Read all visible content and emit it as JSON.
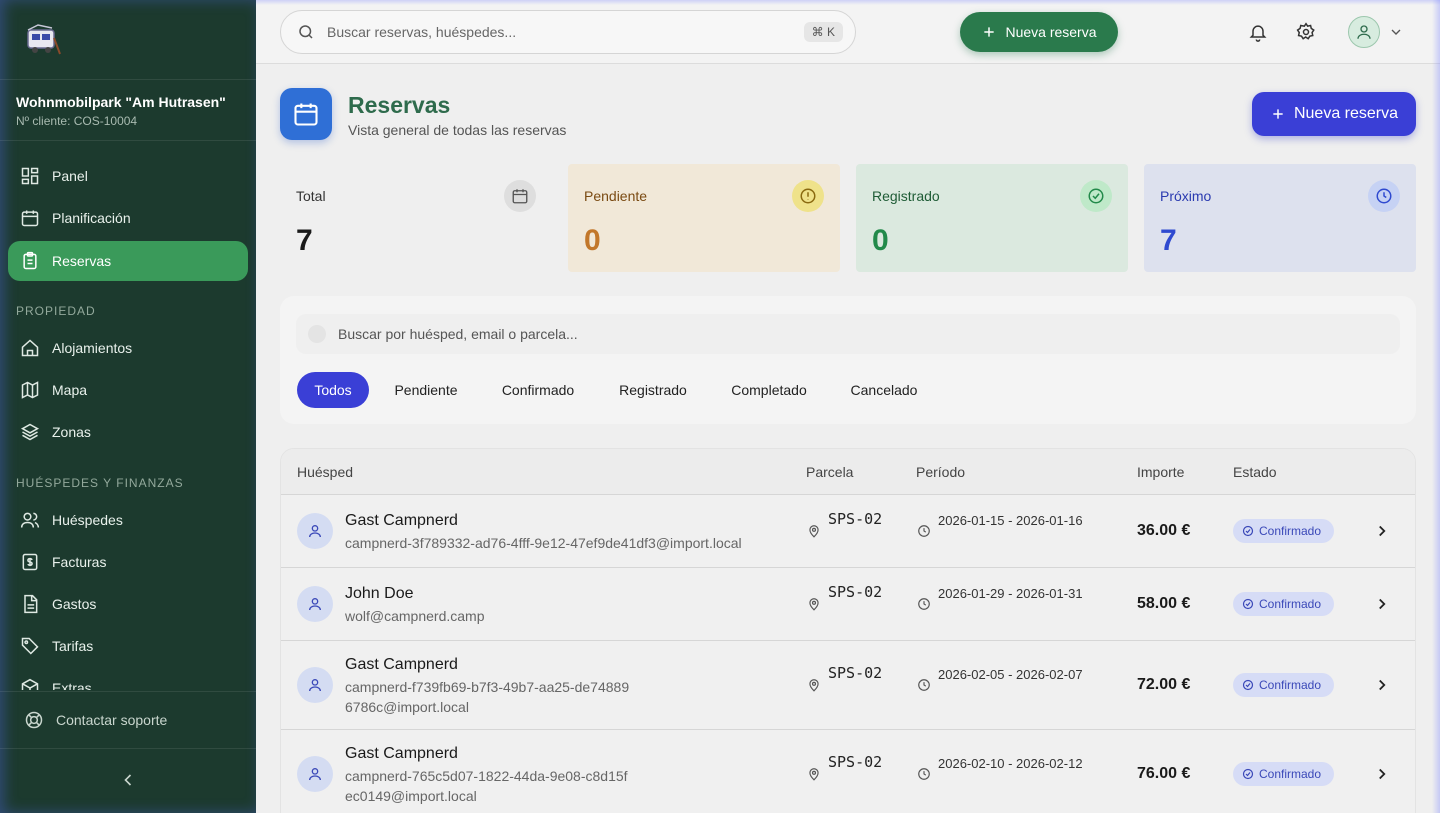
{
  "sidebar": {
    "park_name": "Wohnmobilpark \"Am Hutrasen\"",
    "client_number": "Nº cliente: COS-10004",
    "items": [
      {
        "label": "Panel",
        "icon": "dashboard-icon"
      },
      {
        "label": "Planificación",
        "icon": "calendar-icon"
      },
      {
        "label": "Reservas",
        "icon": "clipboard-icon",
        "active": true
      }
    ],
    "section_property": "PROPIEDAD",
    "property_items": [
      {
        "label": "Alojamientos",
        "icon": "home-icon"
      },
      {
        "label": "Mapa",
        "icon": "map-icon"
      },
      {
        "label": "Zonas",
        "icon": "layers-icon"
      }
    ],
    "section_guests": "HUÉSPEDES Y FINANZAS",
    "guest_items": [
      {
        "label": "Huéspedes",
        "icon": "users-icon"
      },
      {
        "label": "Facturas",
        "icon": "invoice-icon"
      },
      {
        "label": "Gastos",
        "icon": "receipt-icon"
      },
      {
        "label": "Tarifas",
        "icon": "tag-icon"
      },
      {
        "label": "Extras",
        "icon": "package-icon"
      }
    ],
    "support_label": "Contactar soporte"
  },
  "topbar": {
    "search_placeholder": "Buscar reservas, huéspedes...",
    "shortcut": "⌘ K",
    "new_booking": "Nueva reserva"
  },
  "header": {
    "title": "Reservas",
    "subtitle": "Vista general de todas las reservas",
    "new_booking": "Nueva reserva"
  },
  "stats": [
    {
      "label": "Total",
      "value": "7"
    },
    {
      "label": "Pendiente",
      "value": "0"
    },
    {
      "label": "Registrado",
      "value": "0"
    },
    {
      "label": "Próximo",
      "value": "7"
    }
  ],
  "filters": {
    "search_placeholder": "Buscar por huésped, email o parcela...",
    "chips": [
      "Todos",
      "Pendiente",
      "Confirmado",
      "Registrado",
      "Completado",
      "Cancelado"
    ],
    "active": "Todos"
  },
  "table": {
    "columns": [
      "Huésped",
      "Parcela",
      "Período",
      "Importe",
      "Estado"
    ],
    "rows": [
      {
        "name": "Gast Campnerd",
        "email": "campnerd-3f789332-ad76-4fff-9e12-47ef9de41df3@import.local",
        "plot": "SPS-02",
        "period": "2026-01-15 - 2026-01-16",
        "amount": "36.00 €",
        "status": "Confirmado"
      },
      {
        "name": "John Doe",
        "email": "wolf@campnerd.camp",
        "plot": "SPS-02",
        "period": "2026-01-29 - 2026-01-31",
        "amount": "58.00 €",
        "status": "Confirmado"
      },
      {
        "name": "Gast Campnerd",
        "email": "campnerd-f739fb69-b7f3-49b7-aa25-de748896786c@import.local",
        "plot": "SPS-02",
        "period": "2026-02-05 - 2026-02-07",
        "amount": "72.00 €",
        "status": "Confirmado"
      },
      {
        "name": "Gast Campnerd",
        "email": "campnerd-765c5d07-1822-44da-9e08-c8d15fec0149@import.local",
        "plot": "SPS-02",
        "period": "2026-02-10 - 2026-02-12",
        "amount": "76.00 €",
        "status": "Confirmado"
      }
    ]
  },
  "colors": {
    "sidebar_bg": "#1c3a2e",
    "active_green": "#3a9a5a",
    "primary_blue": "#3a3fd6",
    "title_green": "#2e6b4c"
  }
}
